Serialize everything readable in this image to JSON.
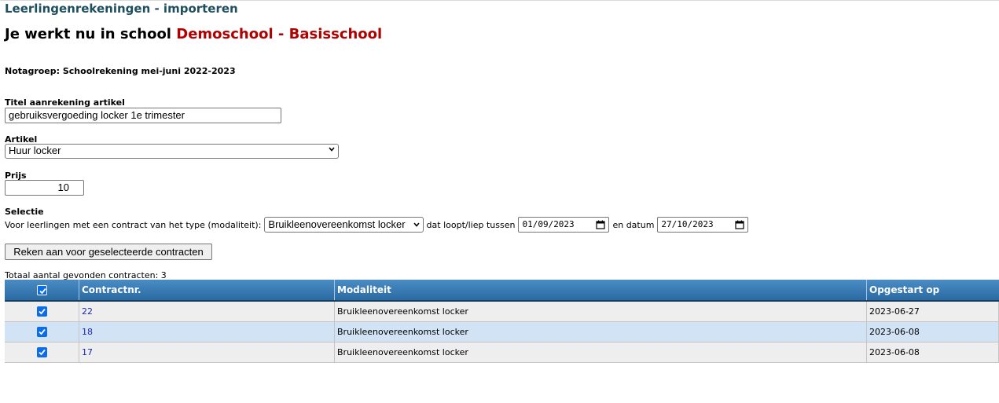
{
  "page": {
    "title": "Leerlingenrekeningen - importeren",
    "school_prefix": "Je werkt nu in school",
    "school_name": "Demoschool - Basisschool",
    "notagroep": "Notagroep: Schoolrekening mei-juni 2022-2023"
  },
  "form": {
    "titel_label": "Titel aanrekening artikel",
    "titel_value": "gebruiksvergoeding locker 1e trimester",
    "artikel_label": "Artikel",
    "artikel_value": "Huur locker",
    "prijs_label": "Prijs",
    "prijs_value": "10",
    "selectie_label": "Selectie",
    "selectie_text_1": "Voor leerlingen met een contract van het type (modaliteit):",
    "modaliteit_value": "Bruikleenovereenkomst locker",
    "selectie_text_2": "dat loopt/liep tussen",
    "date_from": "01/09/2023",
    "selectie_text_3": "en datum",
    "date_to": "27/10/2023",
    "submit_label": "Reken aan voor geselecteerde contracten"
  },
  "results": {
    "total_text": "Totaal aantal gevonden contracten: 3",
    "headers": [
      "Contractnr.",
      "Modaliteit",
      "Opgestart op"
    ],
    "rows": [
      {
        "nr": "22",
        "modaliteit": "Bruikleenovereenkomst locker",
        "opgestart": "2023-06-27",
        "checked": true
      },
      {
        "nr": "18",
        "modaliteit": "Bruikleenovereenkomst locker",
        "opgestart": "2023-06-08",
        "checked": true
      },
      {
        "nr": "17",
        "modaliteit": "Bruikleenovereenkomst locker",
        "opgestart": "2023-06-08",
        "checked": true
      }
    ]
  },
  "colors": {
    "title": "#1d4f5e",
    "school_name": "#b00000",
    "header_bg": "#2a6aa3",
    "row_alt": "#d1e3f4",
    "checkbox": "#0b6ee8"
  }
}
